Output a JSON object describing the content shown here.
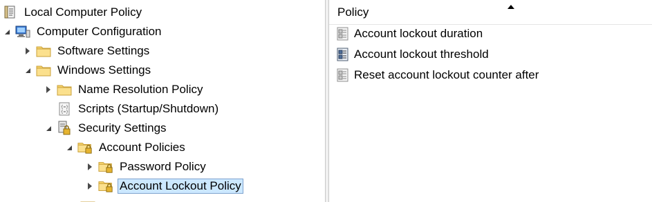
{
  "tree": {
    "items": [
      {
        "label": "Local Computer Policy",
        "icon": "policy-document-icon",
        "twisty": "none"
      },
      {
        "label": "Computer Configuration",
        "icon": "computer-icon",
        "twisty": "open"
      },
      {
        "label": "Software Settings",
        "icon": "folder-icon",
        "twisty": "closed"
      },
      {
        "label": "Windows Settings",
        "icon": "folder-icon",
        "twisty": "open"
      },
      {
        "label": "Name Resolution Policy",
        "icon": "folder-icon",
        "twisty": "closed"
      },
      {
        "label": "Scripts (Startup/Shutdown)",
        "icon": "script-icon",
        "twisty": "none"
      },
      {
        "label": "Security Settings",
        "icon": "security-settings-icon",
        "twisty": "open"
      },
      {
        "label": "Account Policies",
        "icon": "secure-folder-icon",
        "twisty": "open"
      },
      {
        "label": "Password Policy",
        "icon": "secure-folder-icon",
        "twisty": "closed"
      },
      {
        "label": "Account Lockout Policy",
        "icon": "secure-folder-icon",
        "twisty": "closed",
        "selected": true
      }
    ]
  },
  "list": {
    "column_header": "Policy",
    "rows": [
      {
        "label": "Account lockout duration",
        "icon": "policy-setting-icon"
      },
      {
        "label": "Account lockout threshold",
        "icon": "policy-setting-active-icon"
      },
      {
        "label": "Reset account lockout counter after",
        "icon": "policy-setting-icon"
      }
    ]
  },
  "colors": {
    "selection": "#cce8ff",
    "selection_border": "#7da2ce",
    "folder": "#f5d26b"
  }
}
